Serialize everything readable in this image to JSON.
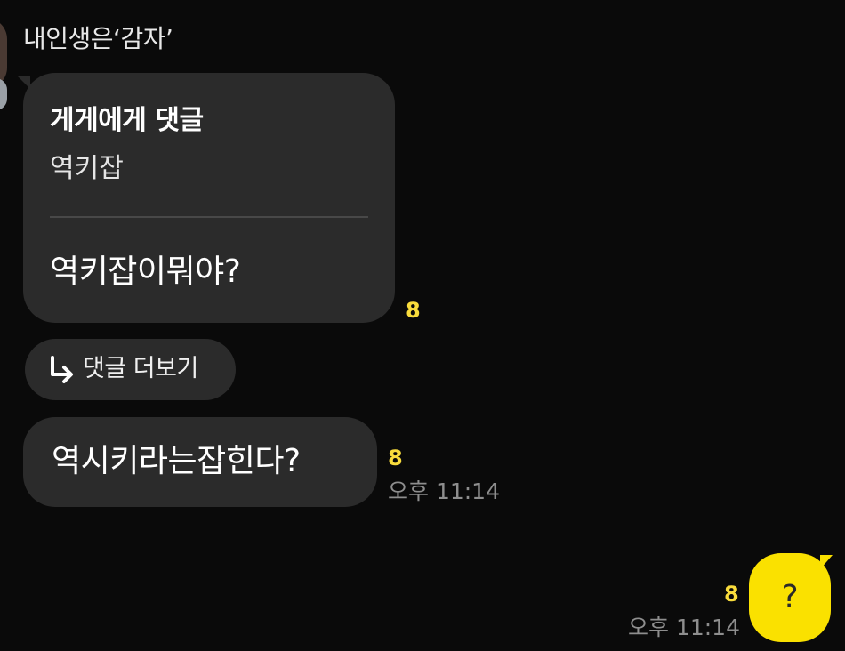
{
  "colors": {
    "background": "#0a0a0a",
    "bubble_other": "#2b2b2b",
    "bubble_mine": "#fae100",
    "unread_count": "#f9dc3c",
    "timestamp": "#8e8e8e"
  },
  "sender": {
    "name": "내인생은‘감자’",
    "avatar_icon": "profile-avatar"
  },
  "messages": [
    {
      "type": "reply",
      "reply_to_label": "게게에게 댓글",
      "quoted_text": "역키잡",
      "text": "역키잡이뭐야?",
      "unread": "8"
    },
    {
      "type": "text",
      "text": "역시키라는잡힌다?",
      "unread": "8",
      "time": "오후 11:14"
    },
    {
      "type": "text",
      "mine": true,
      "text": "?",
      "unread": "8",
      "time": "오후 11:14"
    }
  ],
  "more_comments": {
    "label": "댓글 더보기",
    "icon": "reply-arrow-icon"
  }
}
